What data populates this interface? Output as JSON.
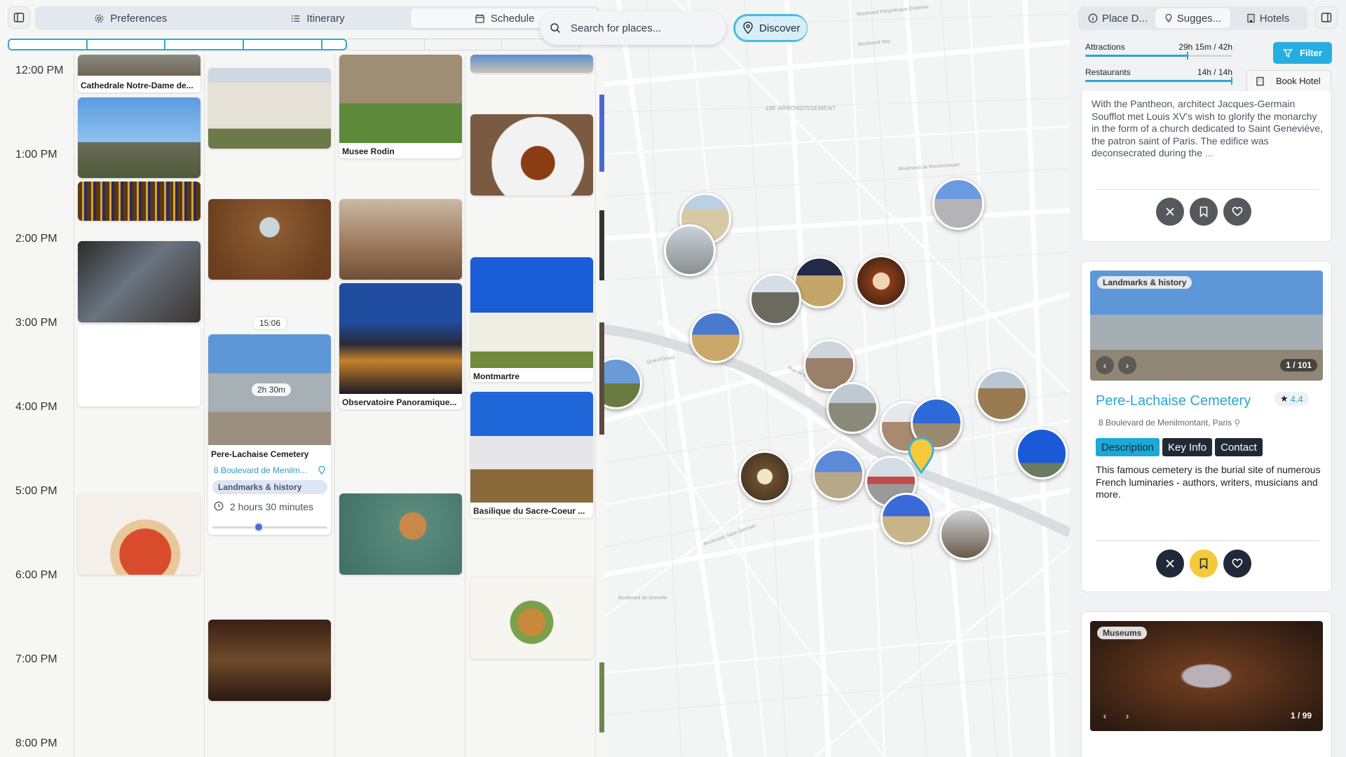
{
  "left": {
    "tabs": [
      {
        "label": "Preferences",
        "icon": "gear-icon"
      },
      {
        "label": "Itinerary",
        "icon": "list-icon"
      },
      {
        "label": "Schedule",
        "icon": "calendar-icon"
      }
    ],
    "active_tab": "Schedule",
    "times": [
      "12:00 PM",
      "1:00 PM",
      "2:00 PM",
      "3:00 PM",
      "4:00 PM",
      "5:00 PM",
      "6:00 PM",
      "7:00 PM",
      "8:00 PM"
    ],
    "cards": {
      "notre_dame": "Cathedrale Notre-Dame de...",
      "rodin": "Musee Rodin",
      "observatoire": "Observatoire Panoramique...",
      "montmartre": "Montmartre",
      "sacre_coeur": "Basilique du Sacre-Coeur ...",
      "pere": {
        "time_badge": "15:06",
        "duration_badge": "2h 30m",
        "name": "Pere-Lachaise Cemetery",
        "address": "8 Boulevard de Menilm...",
        "category": "Landmarks & history",
        "duration": "2 hours 30 minutes",
        "slider_level": 0.4
      }
    }
  },
  "map": {
    "search_placeholder": "Search for places...",
    "discover_label": "Discover",
    "labels": [
      "Boulevard Périphérique Extérieur",
      "Boulevard Ney",
      "18E ARRONDISSEMENT",
      "Boulevard de Rochechouart",
      "Rue de Rivoli",
      "Boulevard de Grenelle",
      "Boulevard Saint-Germain",
      "Quai d'Orsay"
    ]
  },
  "right": {
    "tabs": [
      {
        "label": "Place D...",
        "icon": "info-icon"
      },
      {
        "label": "Sugges...",
        "icon": "lightbulb-icon"
      },
      {
        "label": "Hotels",
        "icon": "building-icon"
      }
    ],
    "budgets": [
      {
        "label": "Attractions",
        "value": "29h 15m / 42h",
        "fill": 0.7
      },
      {
        "label": "Restaurants",
        "value": "14h / 14h",
        "fill": 1.0
      }
    ],
    "filter_label": "Filter",
    "book_hotel_label": "Book Hotel",
    "pantheon_text": "With the Pantheon, architect Jacques-Germain Soufflot met Louis XV's wish to glorify the monarchy in the form of a church dedicated to Saint Geneviève, the patron saint of Paris. The edifice was deconsecrated during the",
    "more_link": "...",
    "card2": {
      "category": "Landmarks & history",
      "counter": "1 / 101",
      "name": "Pere-Lachaise Cemetery",
      "rating": "4.4",
      "address": "8 Boulevard de Menilmontant, Paris",
      "subtabs": [
        "Description",
        "Key Info",
        "Contact"
      ],
      "description": "This famous cemetery is the burial site of numerous French luminaries - authors, writers, musicians and more."
    },
    "card3": {
      "category": "Museums",
      "counter": "1 / 99"
    }
  }
}
